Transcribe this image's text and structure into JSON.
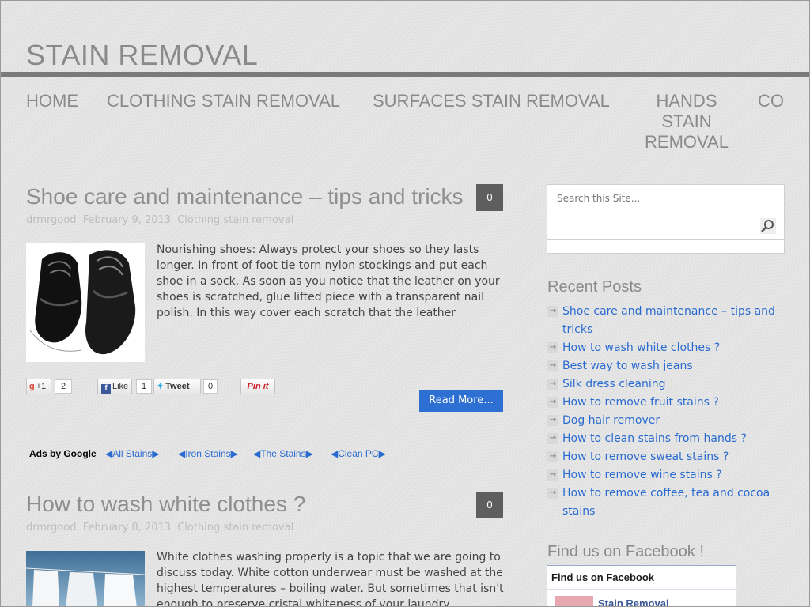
{
  "site": {
    "title": "STAIN REMOVAL"
  },
  "nav": {
    "home": "HOME",
    "clothing": "CLOTHING STAIN REMOVAL",
    "surfaces": "SURFACES STAIN REMOVAL",
    "hands": "HANDS STAIN REMOVAL",
    "co": "CO"
  },
  "posts": [
    {
      "title": "Shoe care and maintenance – tips and tricks",
      "comments": "0",
      "author": "drmrgood",
      "date": "February 9, 2013",
      "category": "Clothing stain removal",
      "excerpt": "Nourishing shoes: Always protect your shoes so they lasts longer. In front of foot tie torn nylon stockings and put each shoe in a sock. As soon as you notice that the leather on your shoes is scratched, glue lifted piece with a transparent nail polish. In this way cover each scratch that the leather",
      "share": {
        "gplus": "+1",
        "gplus_count": "2",
        "like": "Like",
        "like_count": "1",
        "tweet": "Tweet",
        "tweet_count": "0",
        "pin": "Pin it"
      },
      "read_more": "Read More..."
    },
    {
      "title": "How to wash white clothes ?",
      "comments": "0",
      "author": "drmrgood",
      "date": "February 8, 2013",
      "category": "Clothing stain removal",
      "excerpt": "White clothes washing properly is a topic that we are going to discuss today. White cotton underwear must be washed at the highest temperatures – boiling water. But sometimes that isn't enough to preserve cristal whiteness of your laundry"
    }
  ],
  "ads": {
    "label": "Ads by Google",
    "links": [
      "◀All Stains▶",
      "◀Iron Stains▶",
      "◀The Stains▶",
      "◀Clean PC▶"
    ]
  },
  "sidebar": {
    "search_placeholder": "Search this Site...",
    "recent_title": "Recent Posts",
    "recent_posts": [
      "Shoe care and maintenance – tips and tricks",
      "How to wash white clothes ?",
      "Best way to wash jeans",
      "Silk dress cleaning",
      "How to remove fruit stains ?",
      "Dog hair remover",
      "How to clean stains from hands ?",
      "How to remove sweat stains ?",
      "How to remove wine stains ?",
      "How to remove coffee, tea and cocoa stains"
    ],
    "facebook_title": "Find us on Facebook !",
    "facebook_box_title": "Find us on Facebook",
    "facebook_page_name": "Stain Removal"
  },
  "colors": {
    "accent": "#2e6fd4",
    "link": "#2a6bd0",
    "nav_text": "#8a8a8a",
    "title_rule": "#7a7a7a"
  }
}
